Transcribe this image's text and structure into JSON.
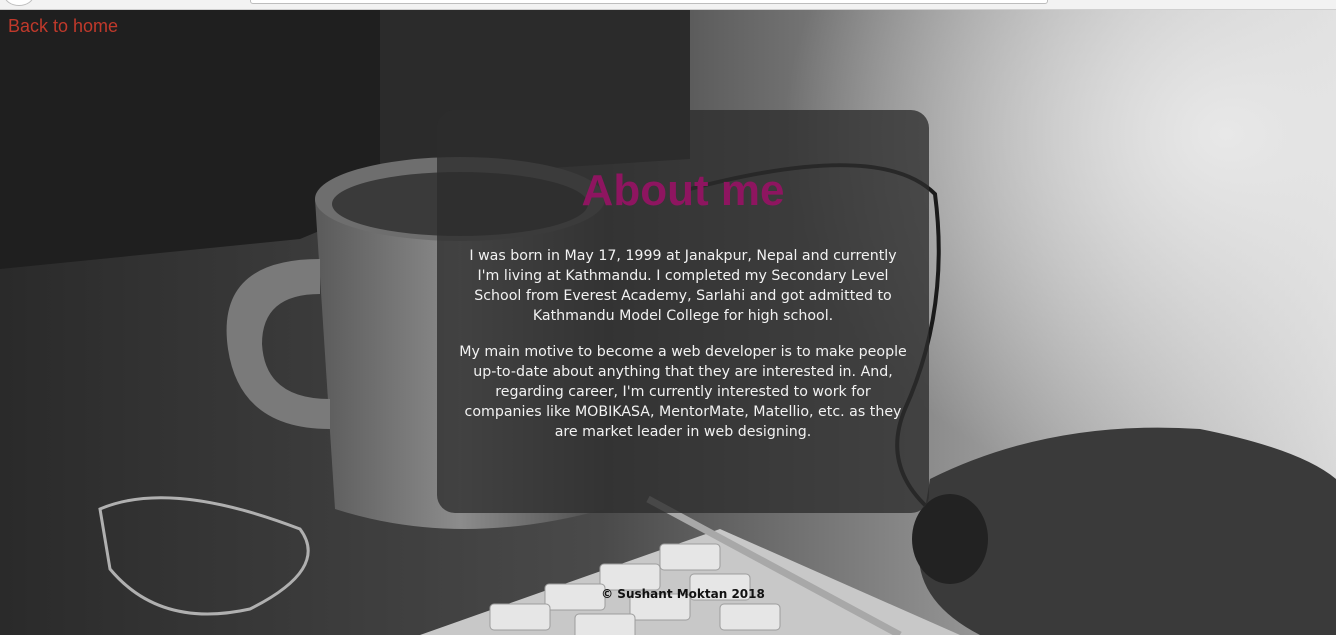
{
  "nav": {
    "back_label": "Back to home"
  },
  "about": {
    "title": "About me",
    "paragraphs": [
      "I was born in May 17, 1999 at Janakpur, Nepal and currently I'm living at Kathmandu. I completed my Secondary Level School from Everest Academy, Sarlahi and got admitted to Kathmandu Model College for high school.",
      "My main motive to become a web developer is to make people up-to-date about anything that they are interested in. And, regarding career, I'm currently interested to work for companies like MOBIKASA, MentorMate, Matellio, etc. as they are market leader in web designing."
    ]
  },
  "footer": {
    "text": "© Sushant Moktan 2018"
  },
  "colors": {
    "back_link": "#c0392b",
    "title": "#8e1560",
    "card_bg": "rgba(45,45,45,0.78)"
  }
}
